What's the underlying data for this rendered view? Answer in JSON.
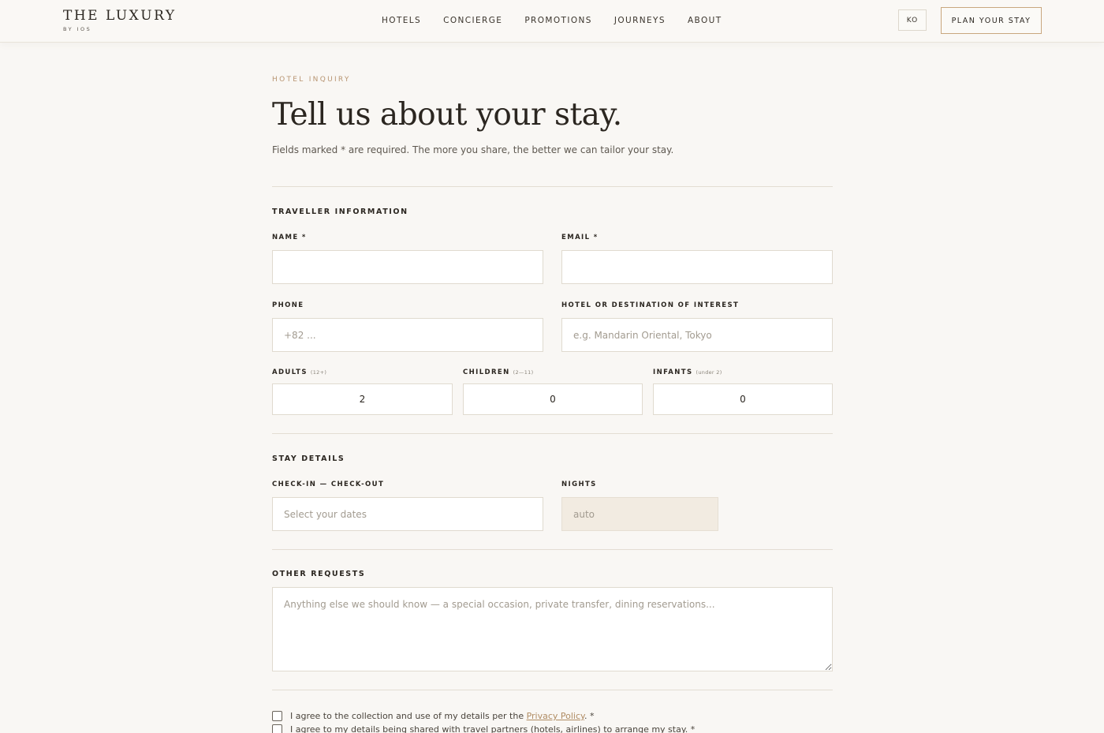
{
  "header": {
    "logo_main": "THE LUXURY",
    "logo_sub": "BY IOS",
    "nav": [
      "HOTELS",
      "CONCIERGE",
      "PROMOTIONS",
      "JOURNEYS",
      "ABOUT"
    ],
    "lang": "KO",
    "cta": "PLAN YOUR STAY"
  },
  "page": {
    "eyebrow": "HOTEL INQUIRY",
    "title": "Tell us about your stay.",
    "subtitle": "Fields marked * are required. The more you share, the better we can tailor your stay."
  },
  "traveller": {
    "section_title": "TRAVELLER INFORMATION",
    "name_label": "NAME *",
    "name_value": "",
    "email_label": "EMAIL *",
    "email_value": "",
    "phone_label": "PHONE",
    "phone_placeholder": "+82 ...",
    "hotel_label": "HOTEL OR DESTINATION OF INTEREST",
    "hotel_placeholder": "e.g. Mandarin Oriental, Tokyo",
    "adults_label": "ADULTS",
    "adults_hint": "(12+)",
    "adults_value": "2",
    "children_label": "CHILDREN",
    "children_hint": "(2—11)",
    "children_value": "0",
    "infants_label": "INFANTS",
    "infants_hint": "(under 2)",
    "infants_value": "0"
  },
  "stay": {
    "section_title": "STAY DETAILS",
    "dates_label": "CHECK-IN — CHECK-OUT",
    "dates_placeholder": "Select your dates",
    "nights_label": "NIGHTS",
    "nights_placeholder": "auto"
  },
  "requests": {
    "section_title": "OTHER REQUESTS",
    "placeholder": "Anything else we should know — a special occasion, private transfer, dining reservations..."
  },
  "consent": {
    "privacy_before": "I agree to the collection and use of my details per the ",
    "privacy_link": "Privacy Policy",
    "privacy_after": ". *",
    "sharing": "I agree to my details being shared with travel partners (hotels, airlines) to arrange my stay. *"
  },
  "colors": {
    "background": "#f9f7f4",
    "accent": "#b89572",
    "cta_border": "#c9a77e",
    "readonly_field": "#f2ebe1"
  }
}
